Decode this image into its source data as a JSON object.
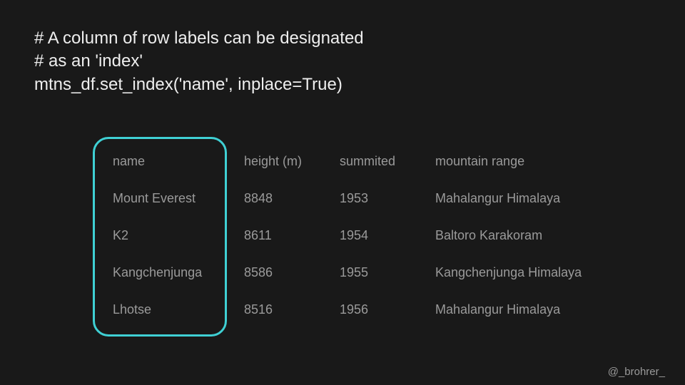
{
  "code": {
    "line1": "# A column of row labels can be designated",
    "line2": "# as an 'index'",
    "line3": "mtns_df.set_index('name', inplace=True)"
  },
  "table": {
    "headers": [
      "name",
      "height (m)",
      "summited",
      "mountain range"
    ],
    "rows": [
      [
        "Mount Everest",
        "8848",
        "1953",
        "Mahalangur Himalaya"
      ],
      [
        "K2",
        "8611",
        "1954",
        "Baltoro Karakoram"
      ],
      [
        "Kangchenjunga",
        "8586",
        "1955",
        "Kangchenjunga Himalaya"
      ],
      [
        "Lhotse",
        "8516",
        "1956",
        "Mahalangur Himalaya"
      ]
    ]
  },
  "footer": "@_brohrer_",
  "highlight_column_index": 0
}
